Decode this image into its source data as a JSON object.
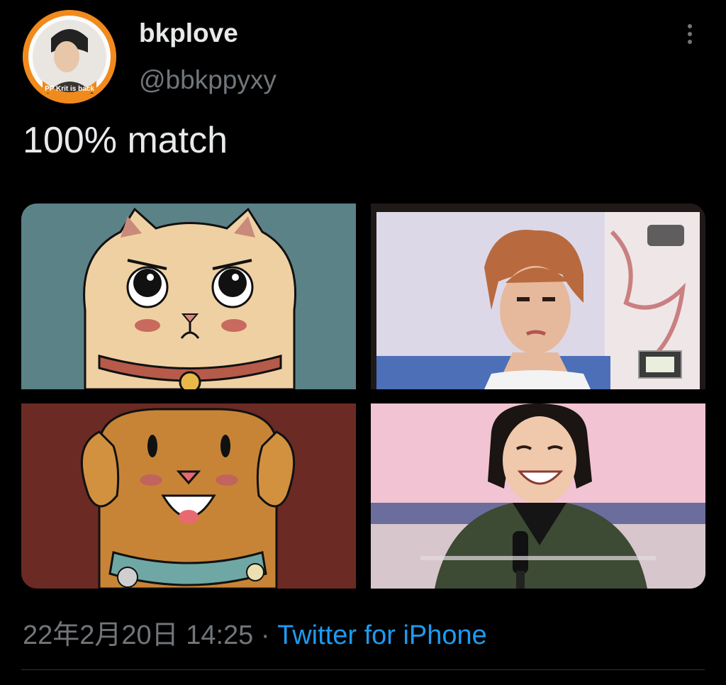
{
  "tweet": {
    "display_name": "bkplove",
    "handle": "@bbkppyxy",
    "text": "100% match",
    "timestamp": "22年2月20日 14:25",
    "separator": "·",
    "source": "Twitter for iPhone"
  },
  "avatar": {
    "badge_text": "PP Krit is back"
  },
  "media": [
    {
      "kind": "cartoon-cat",
      "bg": "#5b8287"
    },
    {
      "kind": "photo-person-frowning",
      "bg": "#d9d6e6"
    },
    {
      "kind": "cartoon-dog",
      "bg": "#6b2a24"
    },
    {
      "kind": "photo-person-laughing",
      "bg": "#f2c3d2"
    }
  ],
  "icons": [
    "more-options-icon"
  ],
  "colors": {
    "background": "#000000",
    "text": "#e7e9ea",
    "muted": "#71767b",
    "link": "#1d9bf0"
  }
}
